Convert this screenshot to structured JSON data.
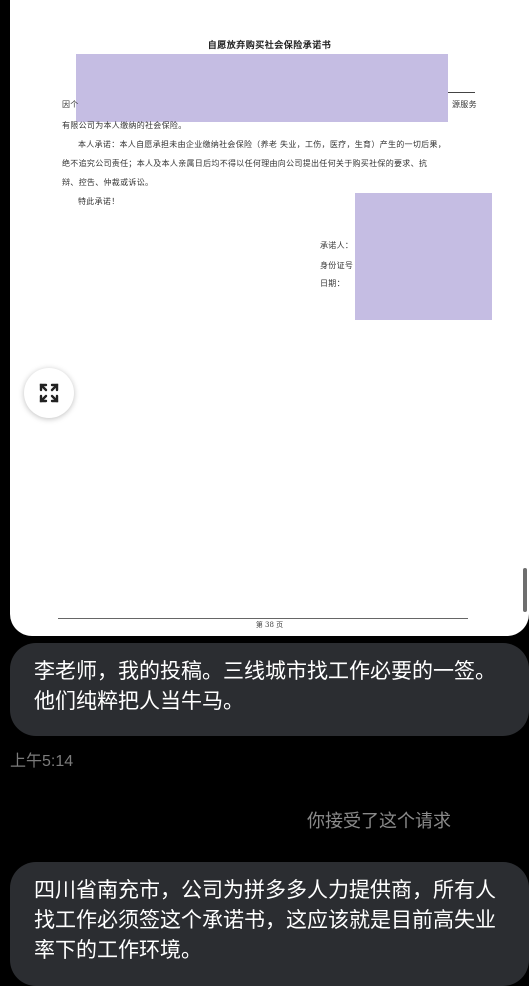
{
  "document": {
    "title": "自愿放弃购买社会保险承诺书",
    "line_1_left": "因个",
    "line_1_right": "源服务",
    "line_2": "有限公司为本人缴纳的社会保险。",
    "line_3": "本人承诺：本人自愿承担未由企业缴纳社会保险（养老 失业，工伤，医疗，生育）产生的一切后果，",
    "line_4": "绝不追究公司责任；本人及本人亲属日后均不得以任何理由向公司提出任何关于购买社保的要求、抗",
    "line_5": "辩、控告、仲裁或诉讼。",
    "line_6": "特此承诺！",
    "sig_promisor": "承诺人：",
    "sig_id": "身份证号",
    "sig_date": "日期：",
    "footer": "第 38 页"
  },
  "messages": [
    {
      "text": "李老师，我的投稿。三线城市找工作必要的一签。他们纯粹把人当牛马。"
    },
    {
      "text": "四川省南充市，公司为拼多多人力提供商，所有人找工作必须签这个承诺书，这应该就是目前高失业率下的工作环境。"
    }
  ],
  "timestamp": "上午5:14",
  "system_notice": "你接受了这个请求",
  "icons": {
    "expand": "expand-icon"
  }
}
